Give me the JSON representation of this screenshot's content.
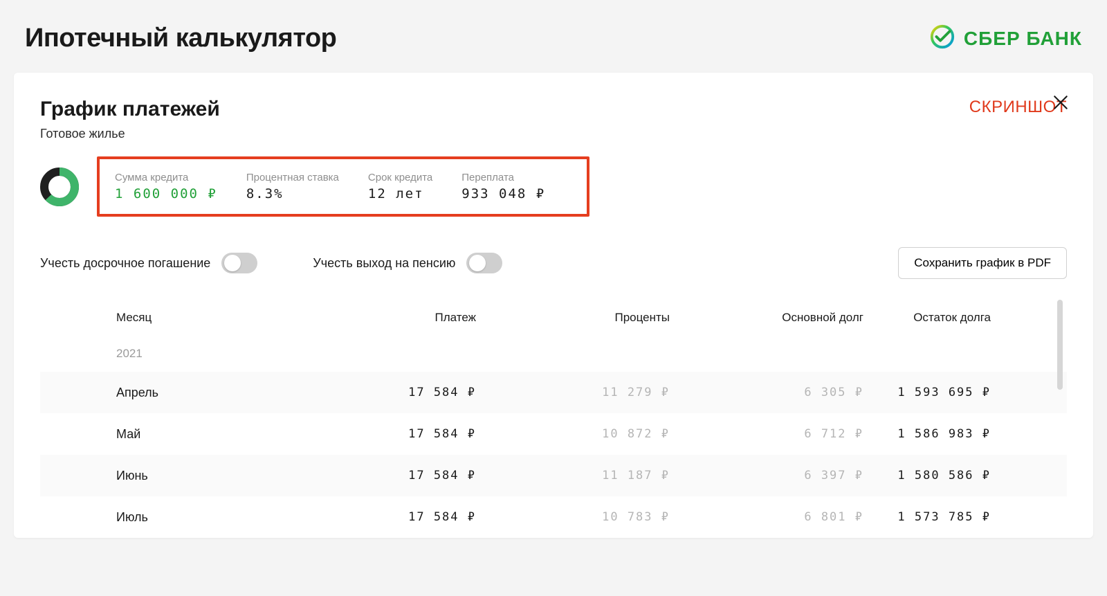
{
  "header": {
    "title": "Ипотечный калькулятор",
    "brand": "СБЕР БАНК"
  },
  "panel": {
    "title": "График платежей",
    "subtitle": "Готовое жилье",
    "annotation": "СКРИНШОТ"
  },
  "summary": {
    "loan_amount_label": "Сумма кредита",
    "loan_amount_value": "1 600 000 ₽",
    "rate_label": "Процентная ставка",
    "rate_value": "8.3%",
    "term_label": "Срок кредита",
    "term_value": "12 лет",
    "overpay_label": "Переплата",
    "overpay_value": "933 048 ₽"
  },
  "toggles": {
    "early_repay": "Учесть досрочное погашение",
    "retirement": "Учесть выход на пенсию"
  },
  "pdf_button": "Сохранить график в PDF",
  "table": {
    "headers": {
      "month": "Месяц",
      "payment": "Платеж",
      "interest": "Проценты",
      "principal": "Основной долг",
      "balance": "Остаток долга"
    },
    "year": "2021",
    "rows": [
      {
        "month": "Апрель",
        "payment": "17 584 ₽",
        "interest": "11 279 ₽",
        "principal": "6 305 ₽",
        "balance": "1 593 695 ₽"
      },
      {
        "month": "Май",
        "payment": "17 584 ₽",
        "interest": "10 872 ₽",
        "principal": "6 712 ₽",
        "balance": "1 586 983 ₽"
      },
      {
        "month": "Июнь",
        "payment": "17 584 ₽",
        "interest": "11 187 ₽",
        "principal": "6 397 ₽",
        "balance": "1 580 586 ₽"
      },
      {
        "month": "Июль",
        "payment": "17 584 ₽",
        "interest": "10 783 ₽",
        "principal": "6 801 ₽",
        "balance": "1 573 785 ₽"
      }
    ]
  }
}
